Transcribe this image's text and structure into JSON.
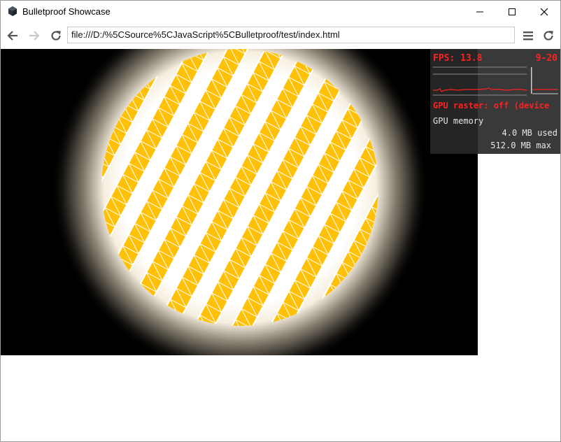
{
  "window": {
    "title": "Bulletproof Showcase",
    "minimize_icon": "minimize-icon",
    "maximize_icon": "maximize-icon",
    "close_icon": "close-icon"
  },
  "toolbar": {
    "back_icon": "arrow-left-icon",
    "forward_icon": "arrow-right-icon",
    "reload_icon": "reload-icon",
    "address": "file:///D:/%5CSource%5CJavaScript%5CBulletproof/test/index.html",
    "menu_icon": "hamburger-menu-icon",
    "reload_right_icon": "reload-icon"
  },
  "scene": {
    "background": "#000000",
    "stripe_color": "#ffc107",
    "glow_color": "#fff3d6"
  },
  "hud": {
    "fps_label": "FPS: 13.8",
    "fps_range": "9-20",
    "gpu_raster": "GPU raster: off (device",
    "gpu_memory_label": "GPU memory",
    "memory_used": "4.0 MB used",
    "memory_max": "512.0 MB max",
    "text_color": "#ff2020"
  }
}
